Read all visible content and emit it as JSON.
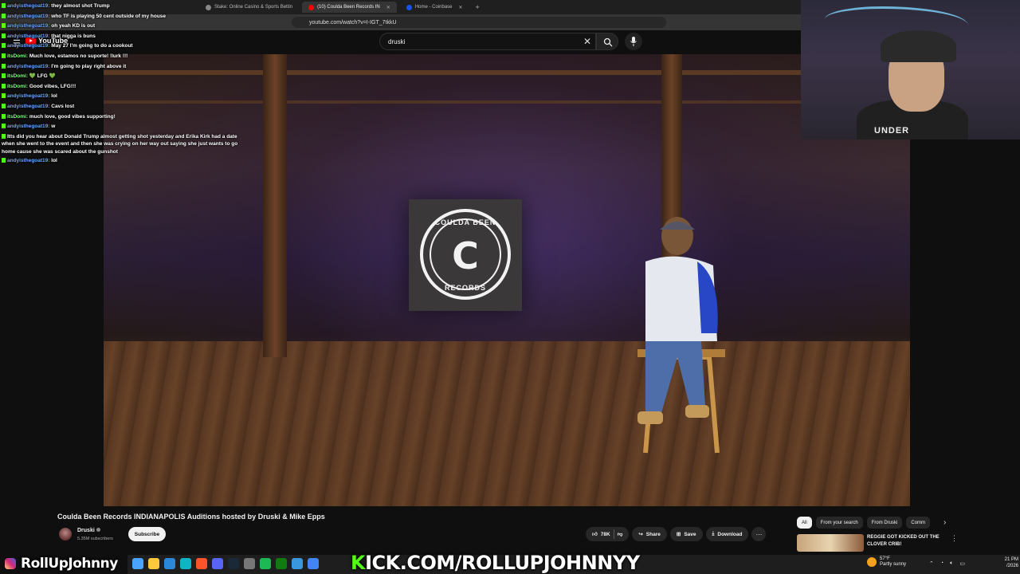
{
  "browser": {
    "tabs": [
      {
        "label": "Stake: Online Casino & Sports Bettin",
        "active": false
      },
      {
        "label": "(10) Coulda Been Records IN",
        "active": true
      },
      {
        "label": "Home - Coinbase",
        "active": false
      }
    ],
    "url": "youtube.com/watch?v=I-IGT_7tkkU"
  },
  "youtube": {
    "logo_text": "YouTube",
    "search_value": "druski"
  },
  "chat": [
    {
      "user": "andyisthegoat19:",
      "msg": "they almost shot Trump",
      "color": "blue"
    },
    {
      "user": "andyisthegoat19:",
      "msg": "who TF is playing 50 cent outside of my house",
      "color": "blue"
    },
    {
      "user": "andyisthegoat19:",
      "msg": "oh yeah KD is out",
      "color": "blue"
    },
    {
      "user": "andyisthegoat19:",
      "msg": "that nigga is buns",
      "color": "blue"
    },
    {
      "user": "andyisthegoat19:",
      "msg": "May 27 I'm going to do a cookout",
      "color": "blue"
    },
    {
      "user": "itsDomi:",
      "msg": "Much love, estamos no suporte! !lurk !!!",
      "color": "green"
    },
    {
      "user": "andyisthegoat19:",
      "msg": "I'm going to play right above it",
      "color": "blue"
    },
    {
      "user": "itsDomi:",
      "msg": "💚 LFG 💚",
      "color": "green"
    },
    {
      "user": "itsDomi:",
      "msg": "Good vibes, LFG!!!",
      "color": "green"
    },
    {
      "user": "andyisthegoat19:",
      "msg": "lol",
      "color": "blue"
    },
    {
      "user": "andyisthegoat19:",
      "msg": "Cavs lost",
      "color": "blue"
    },
    {
      "user": "itsDomi:",
      "msg": "much love, good vibes supporting!",
      "color": "green"
    },
    {
      "user": "andyisthegoat19:",
      "msg": "w",
      "color": "blue"
    },
    {
      "user": "",
      "msg": "Itts did you hear about Donald Trump almost getting shot yesterday and Erika Kirk had a date when she went to the event and then she was crying on her way out saying she just wants to go home cause she was scared about the gunshot",
      "color": "red",
      "wrap": true
    },
    {
      "user": "andyisthegoat19:",
      "msg": "lol",
      "color": "blue"
    }
  ],
  "video": {
    "sign_top": "COULDA BEEN",
    "sign_letter": "C",
    "sign_bottom": "RECORDS",
    "title": "Coulda Been Records INDIANAPOLIS Auditions hosted by Druski & Mike Epps",
    "channel_name": "Druski",
    "subscribers": "5.35M subscribers",
    "subscribe_label": "Subscribe",
    "likes": "78K",
    "share_label": "Share",
    "save_label": "Save",
    "download_label": "Download",
    "more_label": "···"
  },
  "recommendations": {
    "chips": [
      {
        "label": "All",
        "active": true
      },
      {
        "label": "From your search",
        "active": false
      },
      {
        "label": "From Druski",
        "active": false
      },
      {
        "label": "Comm",
        "active": false
      }
    ],
    "first_title": "REGGIE GOT KICKED OUT THE CLOVER CRIB!"
  },
  "webcam": {
    "shirt_text": "UNDER"
  },
  "overlay": {
    "streamer_name": "RollUpJohnny",
    "kick_k": "K",
    "kick_rest": "ICK.COM/ROLLUPJOHNNYY"
  },
  "taskbar": {
    "weather_temp": "57°F",
    "weather_desc": "Partly sunny",
    "time": "21 PM",
    "date": "/2026"
  }
}
